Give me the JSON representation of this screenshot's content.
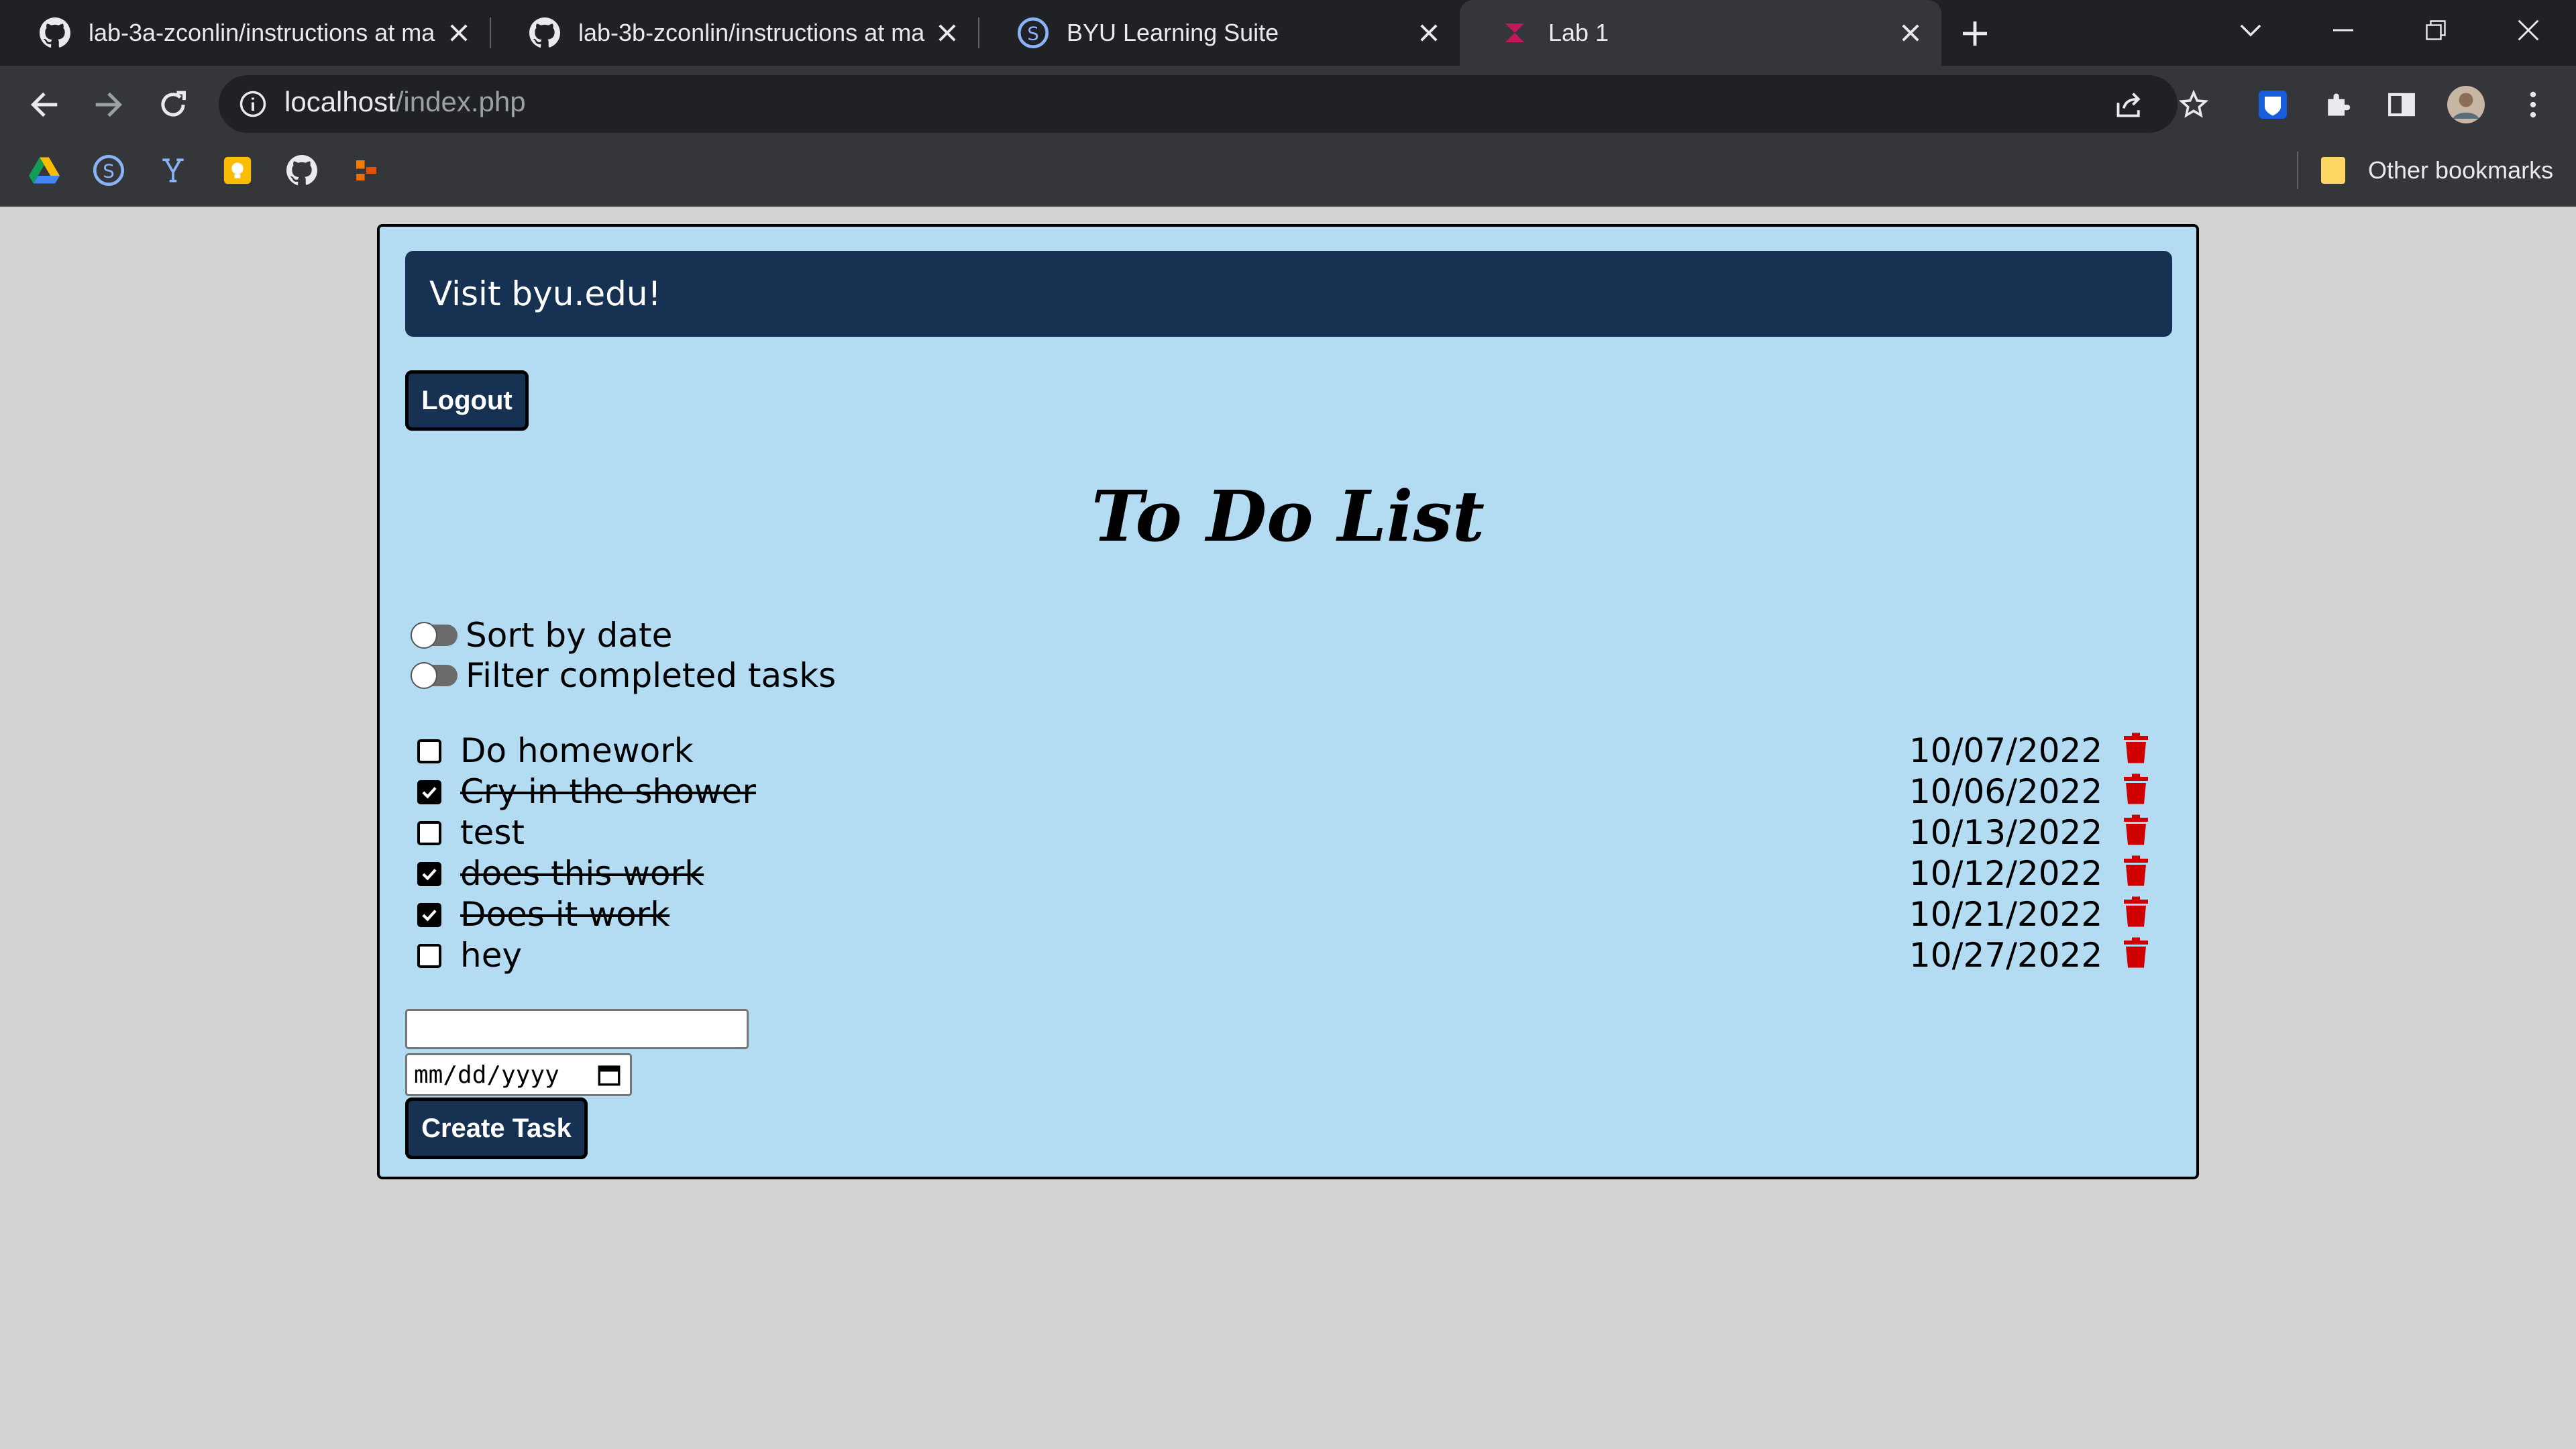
{
  "browser": {
    "tabs": [
      {
        "title": "lab-3a-zconlin/instructions at ma",
        "favicon": "github-icon"
      },
      {
        "title": "lab-3b-zconlin/instructions at ma",
        "favicon": "github-icon"
      },
      {
        "title": "BYU Learning Suite",
        "favicon": "learning-suite-icon"
      },
      {
        "title": "Lab 1",
        "favicon": "lab-icon",
        "active": true
      }
    ],
    "url_host": "localhost",
    "url_path": "/index.php",
    "bookmarks": [
      "drive-icon",
      "learning-suite-icon",
      "y-icon",
      "keep-icon",
      "github-icon",
      "app-icon"
    ],
    "other_bookmarks": "Other bookmarks"
  },
  "page": {
    "banner": "Visit byu.edu!",
    "logout_label": "Logout",
    "title": "To Do List",
    "toggles": {
      "sort_label": "Sort by date",
      "filter_label": "Filter completed tasks"
    },
    "tasks": [
      {
        "name": "Do homework",
        "date": "10/07/2022",
        "completed": false
      },
      {
        "name": "Cry in the shower",
        "date": "10/06/2022",
        "completed": true
      },
      {
        "name": "test",
        "date": "10/13/2022",
        "completed": false
      },
      {
        "name": "does this work",
        "date": "10/12/2022",
        "completed": true
      },
      {
        "name": "Does it work",
        "date": "10/21/2022",
        "completed": true
      },
      {
        "name": "hey",
        "date": "10/27/2022",
        "completed": false
      }
    ],
    "new_task": {
      "text_value": "",
      "date_placeholder": "mm/dd/yyyy",
      "create_label": "Create Task"
    }
  },
  "colors": {
    "banner_bg": "#173152",
    "app_bg": "#b3dcf3",
    "trash": "#d00000"
  }
}
